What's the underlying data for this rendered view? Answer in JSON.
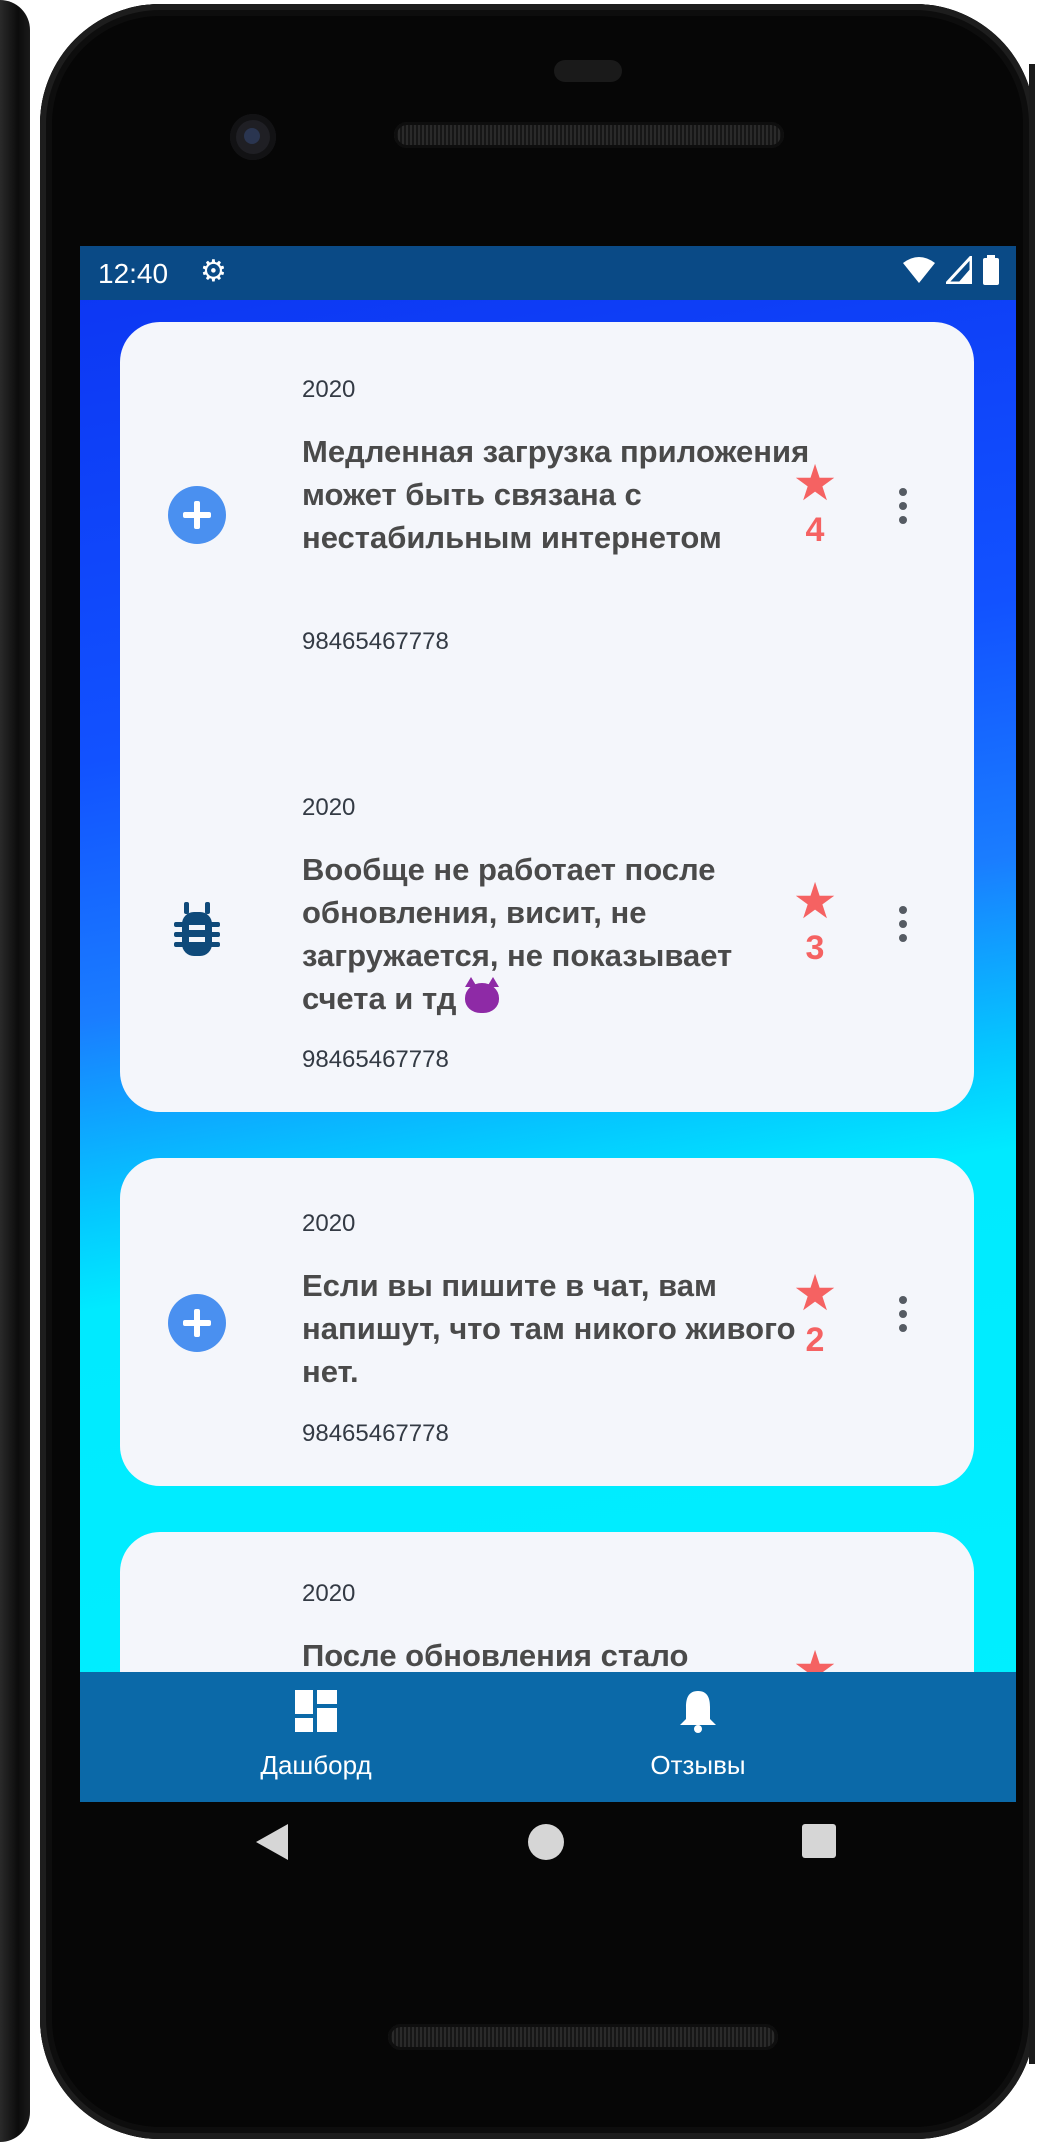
{
  "status_bar": {
    "time": "12:40"
  },
  "cards": [
    {
      "year": "2020",
      "title": "Медленная загрузка приложения может быть связана с нестабильным интернетом",
      "id": "98465467778",
      "rating": "4",
      "icon": "plus-circle-icon"
    },
    {
      "year": "2020",
      "title": "Вообще не работает после обновления, висит, не загружается, не показывает счета и тд",
      "title_emoji": "devil-emoji",
      "id": "98465467778",
      "rating": "3",
      "icon": "bug-icon"
    },
    {
      "year": "2020",
      "title": "Если вы пишите в чат, вам напишут, что там никого живого нет.",
      "id": "98465467778",
      "rating": "2",
      "icon": "plus-circle-icon"
    },
    {
      "year": "2020",
      "title": "После обновления стало",
      "icon": "bug-icon"
    }
  ],
  "bottom_nav": {
    "items": [
      {
        "label": "Дашборд",
        "icon": "dashboard-icon"
      },
      {
        "label": "Отзывы",
        "icon": "bell-icon"
      }
    ]
  },
  "colors": {
    "status_bar": "#0a4a86",
    "bottom_nav": "#0b69a8",
    "card_bg": "#f4f6fb",
    "star": "#f56262",
    "plus_icon": "#4a90f0",
    "bug_icon": "#0f4a7a"
  }
}
